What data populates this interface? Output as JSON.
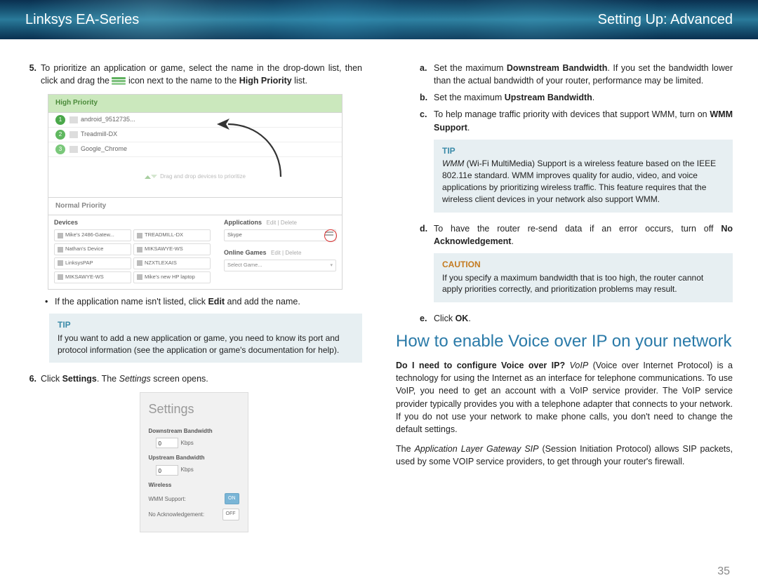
{
  "banner": {
    "left": "Linksys EA-Series",
    "right": "Setting Up: Advanced"
  },
  "left_col": {
    "step5": {
      "num": "5.",
      "pre": "To prioritize an application or game, select the name in the drop-down list, then click and drag the ",
      "post": " icon next to the name to the ",
      "bold": "High Priority",
      "tail": " list."
    },
    "priority_panel": {
      "hp_title": "High Priority",
      "rows": [
        {
          "n": "1",
          "name": "android_9512735..."
        },
        {
          "n": "2",
          "name": "Treadmill-DX"
        },
        {
          "n": "3",
          "name": "Google_Chrome"
        }
      ],
      "dropzone": "Drag and drop devices to prioritize",
      "np_title": "Normal Priority",
      "devices_label": "Devices",
      "devices": [
        "Mike's 2486-Gatew...",
        "TREADMILL-DX",
        "Nathan's Device",
        "MIKSAWYE-WS",
        "LinksysPAP",
        "NZXTLEXAIS",
        "MIKSAWYE-WS",
        "Mike's new HP laptop"
      ],
      "apps_label": "Applications",
      "apps_hint": "Edit  |  Delete",
      "app_selected": "Skype",
      "games_label": "Online Games",
      "games_hint": "Edit  |  Delete",
      "game_select": "Select Game..."
    },
    "bullet": {
      "pre": "If the application name isn't listed, click ",
      "bold": "Edit",
      "post": " and add the name."
    },
    "tip": {
      "title": "TIP",
      "body": "If you want to add a new application or game, you need to know its port and protocol information (see the application or game's documentation for help)."
    },
    "step6": {
      "num": "6.",
      "pre": "Click ",
      "bold": "Settings",
      "post": ". The ",
      "ital": "Settings",
      "tail": " screen opens."
    },
    "settings_panel": {
      "title": "Settings",
      "down_label": "Downstream Bandwidth",
      "down_val": "0",
      "up_label": "Upstream Bandwidth",
      "up_val": "0",
      "unit": "Kbps",
      "wireless": "Wireless",
      "wmm": "WMM Support:",
      "wmm_state": "ON",
      "noack": "No Acknowledgement:",
      "noack_state": "OFF"
    }
  },
  "right_col": {
    "a": {
      "l": "a.",
      "pre": "Set the maximum ",
      "b1": "Downstream Bandwidth",
      "post": ". If you set the bandwidth lower than the actual bandwidth of your router, performance may be limited."
    },
    "b": {
      "l": "b.",
      "pre": "Set the maximum ",
      "b1": "Upstream Bandwidth",
      "post": "."
    },
    "c": {
      "l": "c.",
      "pre": "To help manage traffic priority with devices that support WMM, turn on ",
      "b1": "WMM Support",
      "post": "."
    },
    "tip": {
      "title": "TIP",
      "lead_i": "WMM",
      "body": " (Wi-Fi MultiMedia) Support is a wireless feature based on the IEEE 802.11e standard. WMM improves quality for audio, video, and voice applications by prioritizing wireless traffic. This feature requires that the wireless client devices in your network also support WMM."
    },
    "d": {
      "l": "d.",
      "pre": "To have the router re-send data if an error occurs, turn off ",
      "b1": "No Acknowledgement",
      "post": "."
    },
    "caution": {
      "title": "CAUTION",
      "body": "If you specify a maximum bandwidth that is too high, the router cannot apply priorities correctly, and prioritization problems may result."
    },
    "e": {
      "l": "e.",
      "pre": "Click ",
      "b1": "OK",
      "post": "."
    },
    "h2": "How to enable Voice over IP on your network",
    "para1": {
      "lead_b": "Do I need to configure Voice over IP?",
      "lead_i": " VoIP",
      "body": " (Voice over Internet Protocol) is a technology for using the Internet as an interface for telephone communications. To use VoIP, you need to get an account with a VoIP service provider. The VoIP service provider typically provides you with a telephone adapter that connects to your network. If you do not use your network to make phone calls, you don't need to change the default settings."
    },
    "para2": {
      "pre": "The ",
      "ital": "Application Layer Gateway SIP",
      "post": " (Session Initiation Protocol) allows SIP packets, used by some VOIP service providers, to get through your router's firewall."
    }
  },
  "pagenum": "35"
}
